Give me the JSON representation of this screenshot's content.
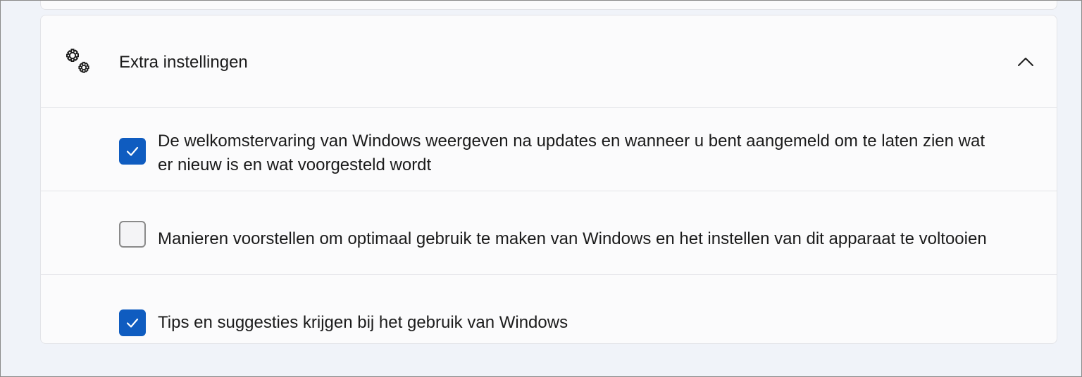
{
  "section": {
    "title": "Extra instellingen",
    "icon": "gears-icon",
    "expanded": true,
    "chevron_icon": "chevron-up-icon"
  },
  "options": [
    {
      "label": "De welkomstervaring van Windows weergeven na updates en wanneer u bent aangemeld om te laten zien wat er nieuw is en wat voorgesteld wordt",
      "checked": true
    },
    {
      "label": "Manieren voorstellen om optimaal gebruik te maken van Windows en het instellen van dit apparaat te voltooien",
      "checked": false
    },
    {
      "label": "Tips en suggesties krijgen bij het gebruik van Windows",
      "checked": true
    }
  ],
  "colors": {
    "accent": "#0f5cc0",
    "background": "#f0f3f9",
    "card": "#fbfbfc",
    "divider": "#e3e4e8"
  }
}
